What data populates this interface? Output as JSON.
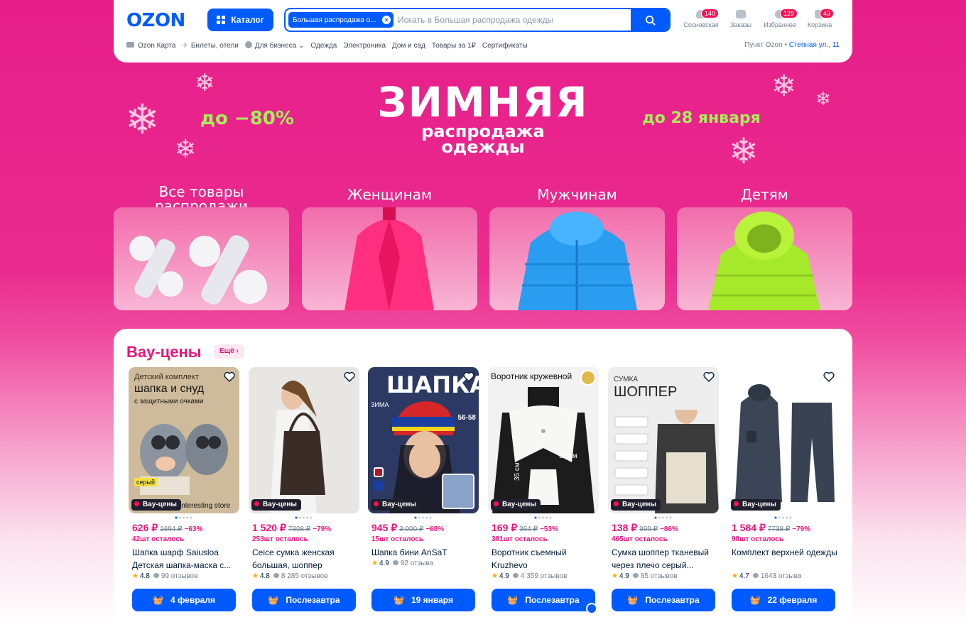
{
  "header": {
    "logo": "OZON",
    "catalog_label": "Каталог",
    "search_chip": "Большая распродажа о...",
    "search_placeholder": "Искать в Большая распродажа одежды",
    "icons": [
      {
        "label": "Сосновская",
        "badge": "140",
        "icon": "user-icon"
      },
      {
        "label": "Заказы",
        "badge": "",
        "icon": "box-icon"
      },
      {
        "label": "Избранное",
        "badge": "129",
        "icon": "heart-icon"
      },
      {
        "label": "Корзина",
        "badge": "43",
        "icon": "cart-icon"
      }
    ],
    "nav": [
      "Ozon Карта",
      "Билеты, отели",
      "Для бизнеса",
      "Одежда",
      "Электроника",
      "Дом и сад",
      "Товары за 1₽",
      "Сертификаты"
    ],
    "pickup_label": "Пункт Ozon •",
    "pickup_address": "Степная ул., 11"
  },
  "promo": {
    "title": "ЗИМНЯЯ",
    "subtitle_1": "распродажа",
    "subtitle_2": "одежды",
    "left_text": "до −80%",
    "right_text": "до 28 января"
  },
  "categories": [
    {
      "label": "Все товары распродажи"
    },
    {
      "label": "Женщинам"
    },
    {
      "label": "Мужчинам"
    },
    {
      "label": "Детям"
    }
  ],
  "deals": {
    "title": "Вау-цены",
    "more_label": "Ещё",
    "badge_label": "Вау-цены",
    "products": [
      {
        "price": "626 ₽",
        "old_price": "1694 ₽",
        "discount": "−63%",
        "left": "42шт осталось",
        "name": "Шапка шарф Saiusloa Детская шапка-маска с...",
        "rating": "4.8",
        "reviews": "99 отзывов",
        "delivery": "4 февраля",
        "img_text_1": "Детский комплект",
        "img_text_2": "шапка и снуд",
        "img_text_3": "с защитными очками",
        "img_tag": "серый",
        "img_store": "interesting store",
        "color": "#c9b79a"
      },
      {
        "price": "1 520 ₽",
        "old_price": "7308 ₽",
        "discount": "−79%",
        "left": "253шт осталось",
        "name": "Сеісе сумка женская большая, шоппер форма...",
        "rating": "4.8",
        "reviews": "8 285 отзывов",
        "delivery": "Послезавтра",
        "color": "#e6e4e1"
      },
      {
        "price": "945 ₽",
        "old_price": "3 000 ₽",
        "discount": "−68%",
        "left": "15шт осталось",
        "name": "Шапка бини AnSaT",
        "rating": "4.9",
        "reviews": "92 отзыва",
        "delivery": "19 января",
        "img_text_1": "ШАПКА",
        "img_text_2": "ЗИМА",
        "img_text_3": "56-58",
        "color": "#2c3a63"
      },
      {
        "price": "169 ₽",
        "old_price": "364 ₽",
        "discount": "−53%",
        "left": "381шт осталось",
        "name": "Воротник съемный Kruzhevo",
        "rating": "4.9",
        "reviews": "4 359 отзывов",
        "delivery": "Послезавтра",
        "img_text_1": "Воротник кружевной",
        "img_text_2": "30 см",
        "img_text_3": "35 см",
        "color": "#f1f1f1"
      },
      {
        "price": "138 ₽",
        "old_price": "999 ₽",
        "discount": "−86%",
        "left": "465шт осталось",
        "name": "Сумка шоппер тканевый через плечо серый...",
        "rating": "4.9",
        "reviews": "85 отзывов",
        "delivery": "Послезавтра",
        "img_text_1": "СУМКА",
        "img_text_2": "ШОППЕР",
        "color": "#ececec"
      },
      {
        "price": "1 584 ₽",
        "old_price": "7738 ₽",
        "discount": "−79%",
        "left": "98шт осталось",
        "name": "Комплект верхней одежды",
        "rating": "4.7",
        "reviews": "1643 отзыва",
        "delivery": "22 февраля",
        "color": "#ffffff"
      }
    ]
  },
  "colors": {
    "brand": "#005bff",
    "pink": "#e61e8a",
    "sale": "#f1117e",
    "lime": "#a7ef5a"
  }
}
